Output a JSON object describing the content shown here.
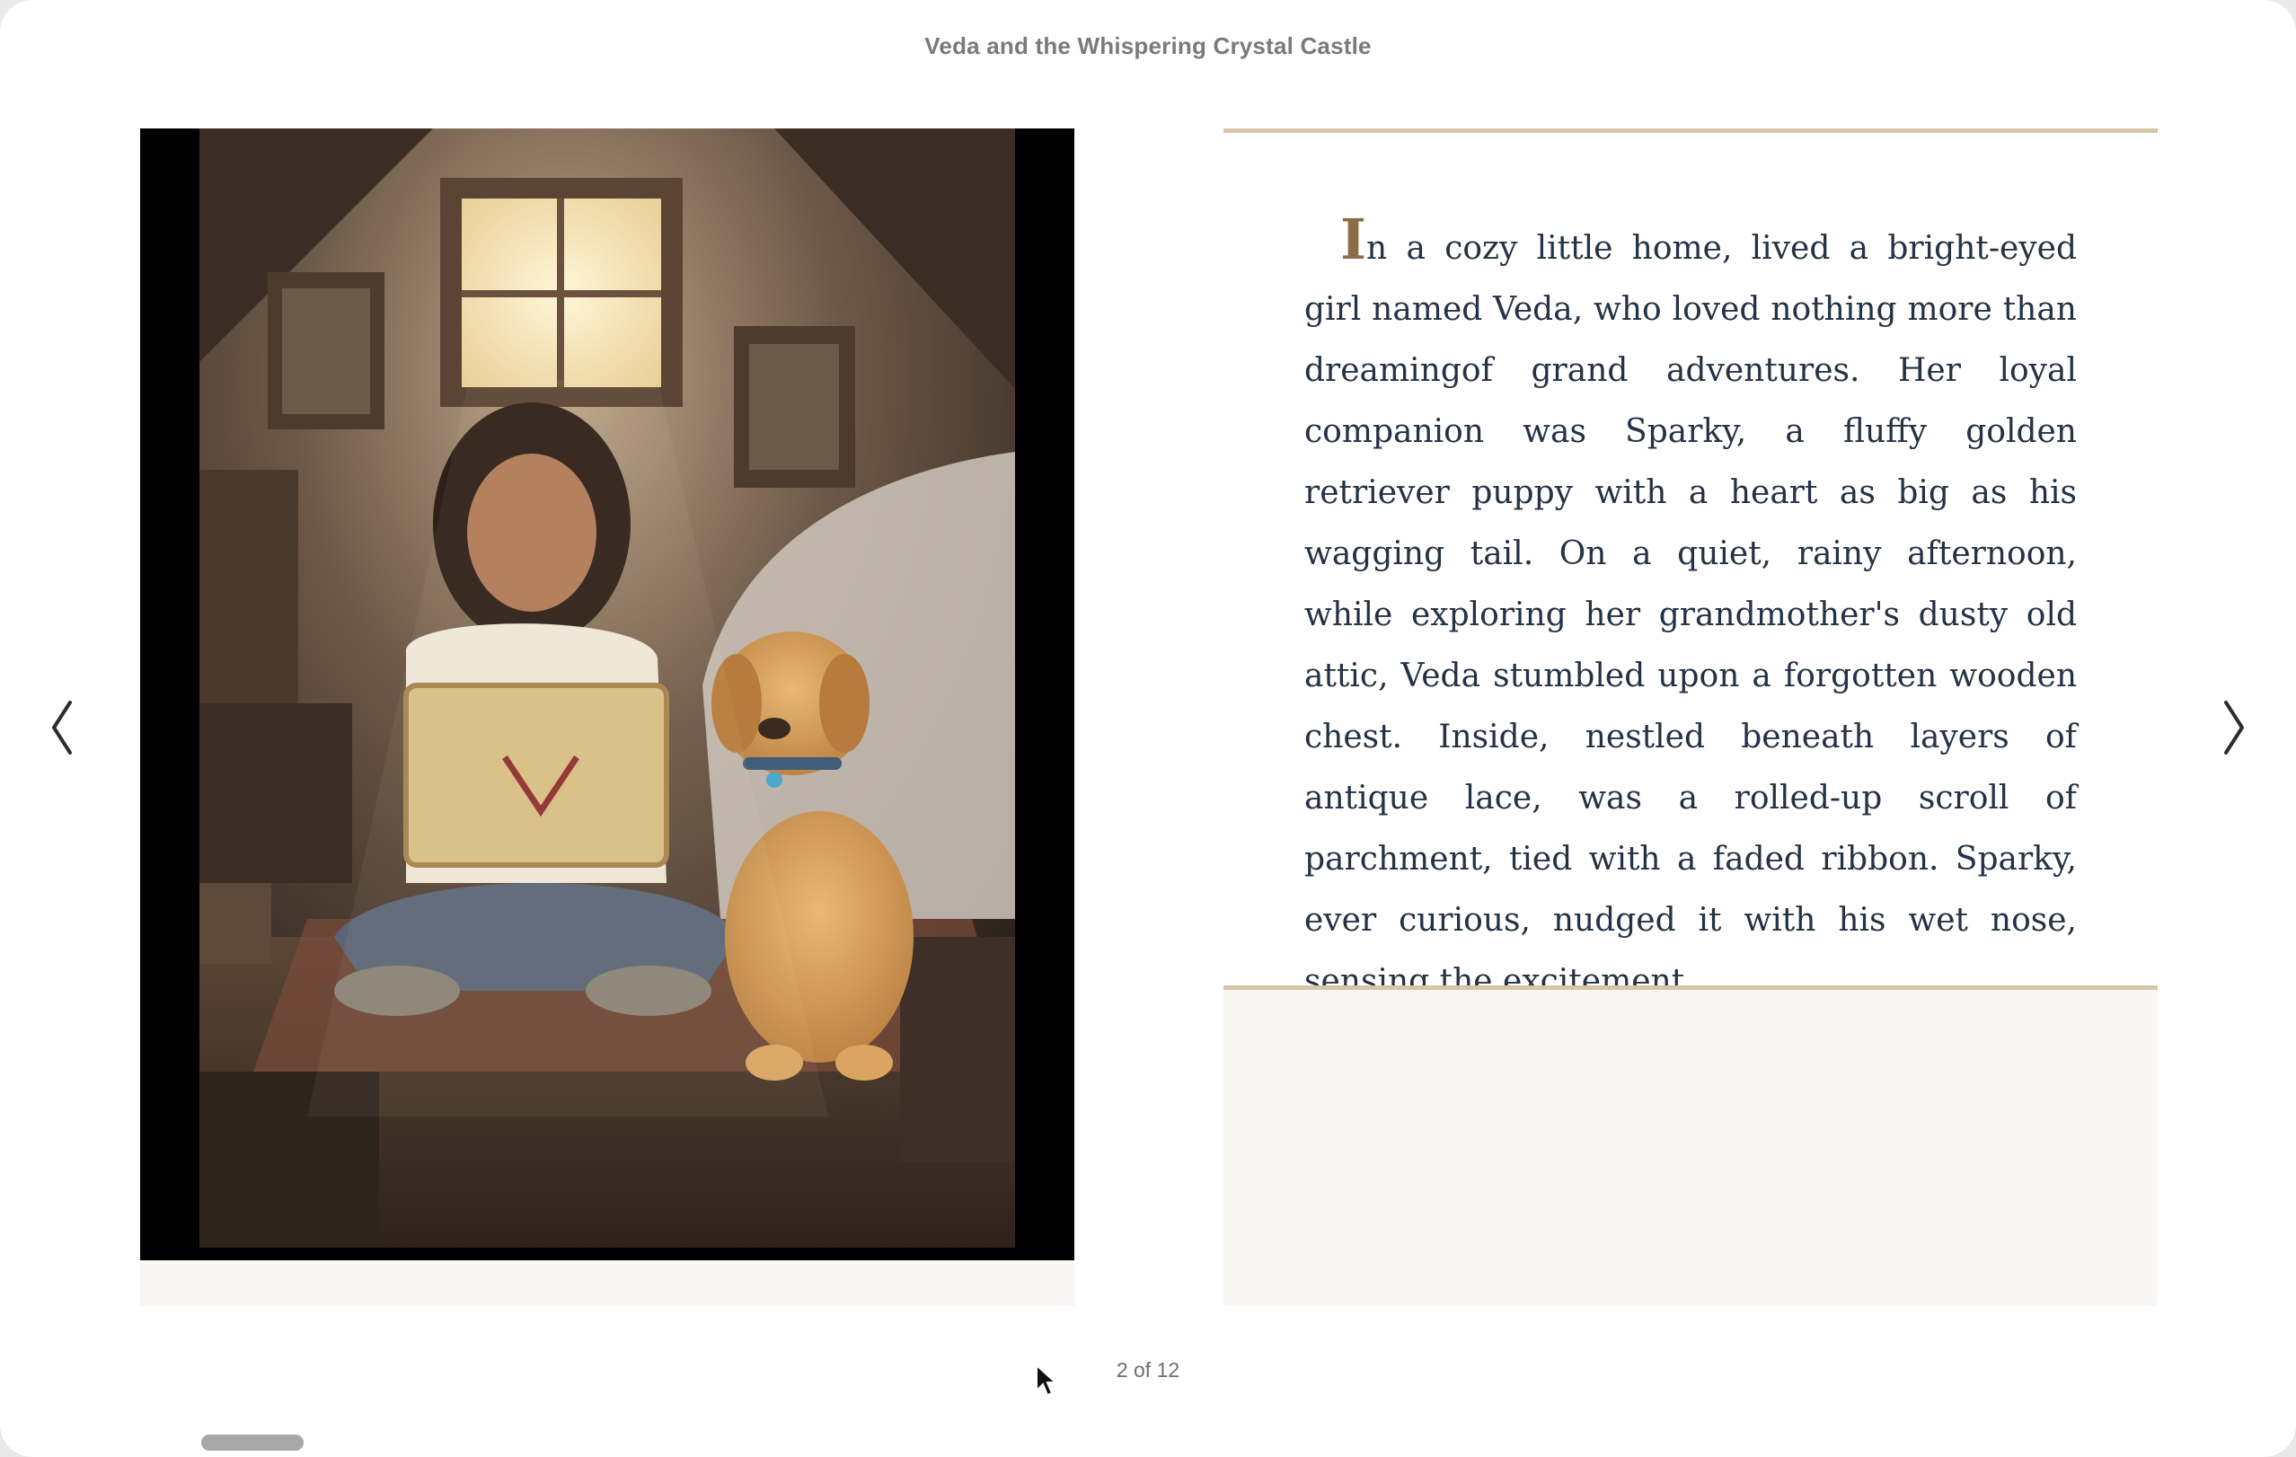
{
  "book": {
    "title": "Veda and the Whispering Crystal Castle"
  },
  "illustration": {
    "alt": "Girl sitting on attic floor reading a rolled parchment map beside a golden retriever puppy"
  },
  "story": {
    "dropcap": "I",
    "text": "n a cozy little home, lived a bright-eyed girl named Veda, who loved nothing more than dream­ingof grand adventures. Her loyal companion was Sparky, a fluffy golden retriever puppy with a heart as big as his wagging tail. On a quiet, rainy after­noon, while exploring her grandmother's dusty old attic, Veda stumbled upon a forgotten wooden chest. Inside, nestled beneath layers of antique lace, was a rolled-up scroll of parchment, tied with a faded ribbon. Sparky, ever curious, nudged it with his wet nose, sensing the excitement."
  },
  "navigation": {
    "prev_icon": "chevron-left-icon",
    "next_icon": "chevron-right-icon",
    "page_indicator": "2 of 12"
  },
  "colors": {
    "accent_rule": "#d6c6a6",
    "dropcap": "#8a6d47",
    "body_text": "#243245",
    "page_fill": "#f8f7f4"
  }
}
